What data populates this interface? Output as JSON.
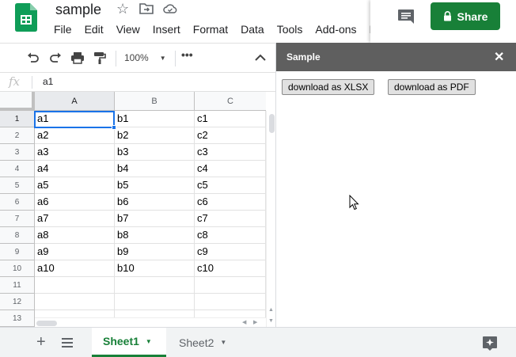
{
  "header": {
    "title": "sample",
    "menus": [
      "File",
      "Edit",
      "View",
      "Insert",
      "Format",
      "Data",
      "Tools",
      "Add-ons",
      "H"
    ],
    "share_label": "Share"
  },
  "toolbar": {
    "zoom": "100%"
  },
  "formula_bar": {
    "fx_label": "fx",
    "value": "a1"
  },
  "grid": {
    "columns": [
      "A",
      "B",
      "C"
    ],
    "rows": [
      {
        "n": "1",
        "cells": [
          "a1",
          "b1",
          "c1"
        ]
      },
      {
        "n": "2",
        "cells": [
          "a2",
          "b2",
          "c2"
        ]
      },
      {
        "n": "3",
        "cells": [
          "a3",
          "b3",
          "c3"
        ]
      },
      {
        "n": "4",
        "cells": [
          "a4",
          "b4",
          "c4"
        ]
      },
      {
        "n": "5",
        "cells": [
          "a5",
          "b5",
          "c5"
        ]
      },
      {
        "n": "6",
        "cells": [
          "a6",
          "b6",
          "c6"
        ]
      },
      {
        "n": "7",
        "cells": [
          "a7",
          "b7",
          "c7"
        ]
      },
      {
        "n": "8",
        "cells": [
          "a8",
          "b8",
          "c8"
        ]
      },
      {
        "n": "9",
        "cells": [
          "a9",
          "b9",
          "c9"
        ]
      },
      {
        "n": "10",
        "cells": [
          "a10",
          "b10",
          "c10"
        ]
      },
      {
        "n": "11",
        "cells": [
          "",
          "",
          ""
        ]
      },
      {
        "n": "12",
        "cells": [
          "",
          "",
          ""
        ]
      },
      {
        "n": "13",
        "cells": [
          "",
          "",
          ""
        ]
      }
    ],
    "selected_cell": "A1"
  },
  "sidebar": {
    "title": "Sample",
    "close": "✕",
    "buttons": [
      "download as XLSX",
      "download as PDF"
    ]
  },
  "sheets": {
    "add": "+",
    "tabs": [
      {
        "label": "Sheet1",
        "active": true
      },
      {
        "label": "Sheet2",
        "active": false
      }
    ]
  },
  "colors": {
    "accent_green": "#188038",
    "selection_blue": "#1a73e8",
    "sidebar_header": "#5f5f5f"
  },
  "icons": [
    "sheets-logo-icon",
    "star-icon",
    "move-folder-icon",
    "cloud-saved-icon",
    "comment-icon",
    "lock-icon",
    "undo-icon",
    "redo-icon",
    "print-icon",
    "paint-format-icon",
    "more-icon",
    "collapse-icon",
    "add-sheet-icon",
    "all-sheets-icon",
    "explore-icon",
    "mouse-cursor-icon"
  ]
}
